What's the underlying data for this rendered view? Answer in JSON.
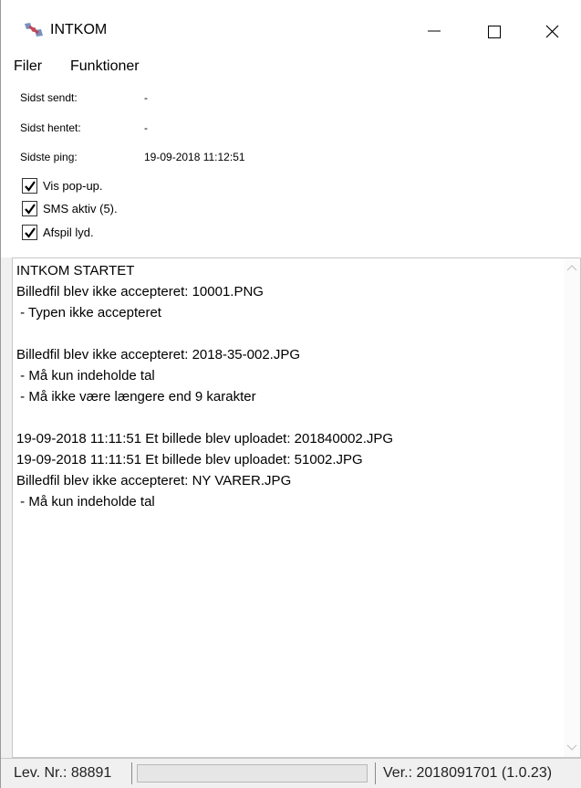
{
  "window": {
    "title": "INTKOM"
  },
  "icons": {
    "app": "satellite-icon",
    "minimize": "minimize-icon",
    "maximize": "maximize-icon",
    "close": "close-icon"
  },
  "menu": {
    "items": [
      "Filer",
      "Funktioner"
    ]
  },
  "info": {
    "sent_label": "Sidst sendt:",
    "sent_value": "-",
    "fetched_label": "Sidst hentet:",
    "fetched_value": "-",
    "ping_label": "Sidste ping:",
    "ping_value": "19-09-2018 11:12:51"
  },
  "options": [
    {
      "label": "Vis pop-up.",
      "checked": true
    },
    {
      "label": "SMS aktiv (5).",
      "checked": true
    },
    {
      "label": "Afspil lyd.",
      "checked": true
    }
  ],
  "log": {
    "lines": [
      "INTKOM STARTET",
      "Billedfil blev ikke accepteret: 10001.PNG",
      " - Typen ikke accepteret",
      "",
      "Billedfil blev ikke accepteret: 2018-35-002.JPG",
      " - Må kun indeholde tal",
      " - Må ikke være længere end 9 karakter",
      "",
      "19-09-2018 11:11:51 Et billede blev uploadet: 201840002.JPG",
      "19-09-2018 11:11:51 Et billede blev uploadet: 51002.JPG",
      "Billedfil blev ikke accepteret: NY VARER.JPG",
      " - Må kun indeholde tal"
    ]
  },
  "status": {
    "lev_nr": "Lev. Nr.: 88891",
    "progress": 0,
    "version": "Ver.: 2018091701 (1.0.23)"
  }
}
